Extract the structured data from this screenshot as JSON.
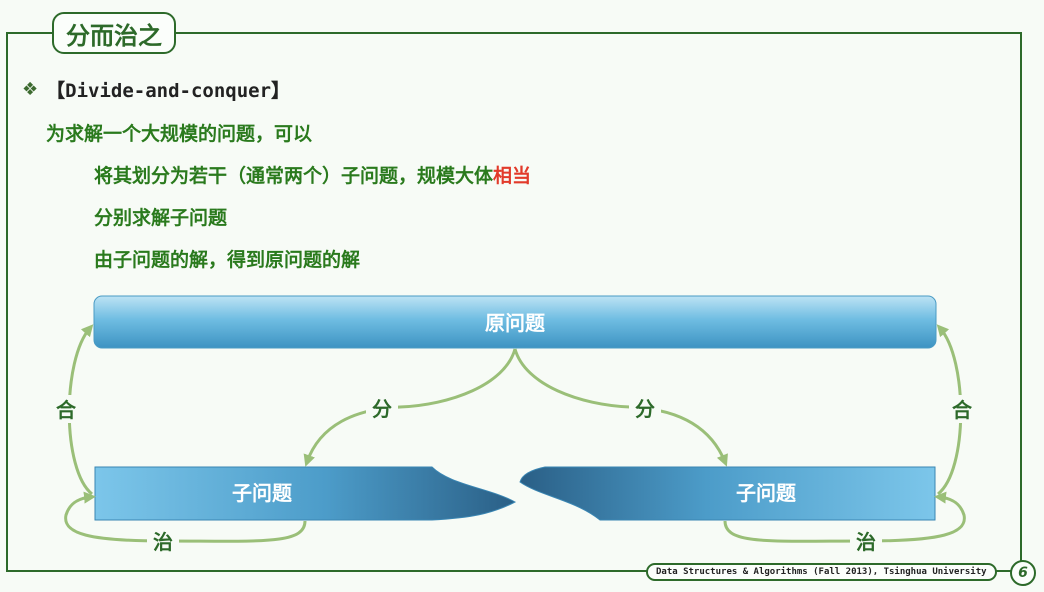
{
  "header": {
    "title": "分而治之"
  },
  "content": {
    "bullet_icon": "diamond-bullet-icon",
    "heading": "【Divide-and-conquer】",
    "intro": "为求解一个大规模的问题，可以",
    "step1_text": "将其划分为若干（通常两个）子问题，规模大体",
    "step1_highlight": "相当",
    "step2": "分别求解子问题",
    "step3": "由子问题的解，得到原问题的解"
  },
  "diagram": {
    "original": "原问题",
    "sub_left": "子问题",
    "sub_right": "子问题",
    "divide_left": "分",
    "divide_right": "分",
    "combine_left": "合",
    "combine_right": "合",
    "conquer_left": "治",
    "conquer_right": "治"
  },
  "footer": {
    "course": "Data Structures & Algorithms (Fall 2013), Tsinghua University",
    "page": "6"
  },
  "colors": {
    "accent": "#2d6a2a",
    "text_green": "#2a7a1d",
    "highlight": "#e23a2a",
    "box_blue": "#5aaed4"
  }
}
